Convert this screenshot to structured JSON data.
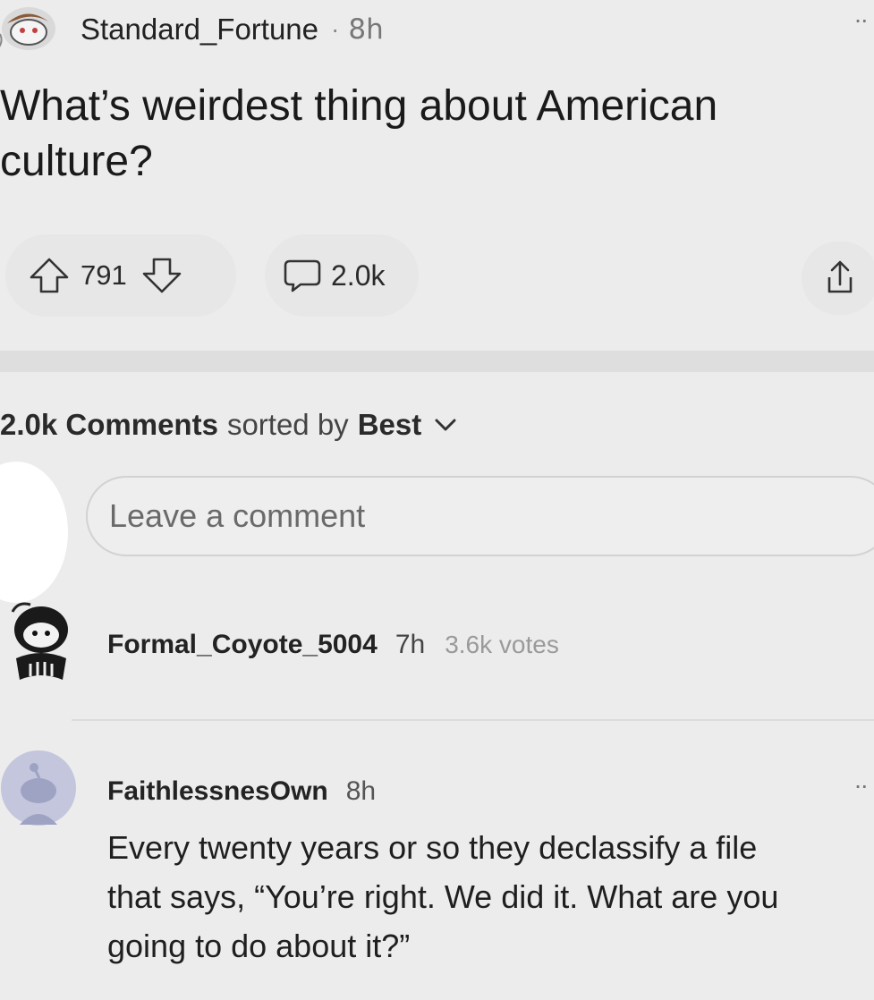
{
  "post": {
    "author": "Standard_Fortune",
    "separator": "·",
    "time": "8h",
    "menu": "··",
    "title": "What’s weirdest thing about American culture?",
    "upvote_icon": "arrow-up-outline-icon",
    "score": "791",
    "downvote_icon": "arrow-down-outline-icon",
    "comment_icon": "speech-bubble-icon",
    "comment_count": "2.0k",
    "share_icon": "share-icon"
  },
  "sort": {
    "count": "2.0k Comments",
    "text": "sorted by",
    "value": "Best",
    "chevron_icon": "chevron-down-icon"
  },
  "comment_box": {
    "placeholder": "Leave a comment"
  },
  "comments": [
    {
      "author": "Formal_Coyote_5004",
      "time": "7h",
      "votes": "3.6k votes",
      "avatar_icon": "snoo-avatar-icon"
    },
    {
      "author": "FaithlessnesOwn",
      "time": "8h",
      "menu": "··",
      "avatar_icon": "default-snoo-avatar-icon",
      "body_lines": [
        "Every twenty years or so they declassify a file",
        "that says, “You’re right. We did it. What are you",
        "going to do about it?”"
      ]
    }
  ],
  "colors": {
    "background": "#ececec",
    "pill": "#e7e7e7",
    "default_avatar": "#c3c6dc"
  }
}
